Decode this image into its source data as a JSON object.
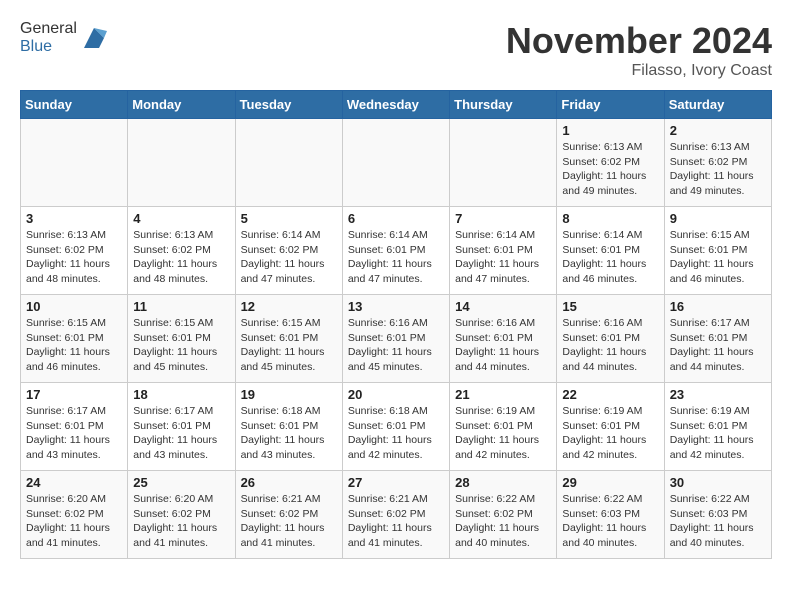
{
  "header": {
    "logo_general": "General",
    "logo_blue": "Blue",
    "month": "November 2024",
    "location": "Filasso, Ivory Coast"
  },
  "weekdays": [
    "Sunday",
    "Monday",
    "Tuesday",
    "Wednesday",
    "Thursday",
    "Friday",
    "Saturday"
  ],
  "weeks": [
    [
      {
        "day": "",
        "info": ""
      },
      {
        "day": "",
        "info": ""
      },
      {
        "day": "",
        "info": ""
      },
      {
        "day": "",
        "info": ""
      },
      {
        "day": "",
        "info": ""
      },
      {
        "day": "1",
        "info": "Sunrise: 6:13 AM\nSunset: 6:02 PM\nDaylight: 11 hours and 49 minutes."
      },
      {
        "day": "2",
        "info": "Sunrise: 6:13 AM\nSunset: 6:02 PM\nDaylight: 11 hours and 49 minutes."
      }
    ],
    [
      {
        "day": "3",
        "info": "Sunrise: 6:13 AM\nSunset: 6:02 PM\nDaylight: 11 hours and 48 minutes."
      },
      {
        "day": "4",
        "info": "Sunrise: 6:13 AM\nSunset: 6:02 PM\nDaylight: 11 hours and 48 minutes."
      },
      {
        "day": "5",
        "info": "Sunrise: 6:14 AM\nSunset: 6:02 PM\nDaylight: 11 hours and 47 minutes."
      },
      {
        "day": "6",
        "info": "Sunrise: 6:14 AM\nSunset: 6:01 PM\nDaylight: 11 hours and 47 minutes."
      },
      {
        "day": "7",
        "info": "Sunrise: 6:14 AM\nSunset: 6:01 PM\nDaylight: 11 hours and 47 minutes."
      },
      {
        "day": "8",
        "info": "Sunrise: 6:14 AM\nSunset: 6:01 PM\nDaylight: 11 hours and 46 minutes."
      },
      {
        "day": "9",
        "info": "Sunrise: 6:15 AM\nSunset: 6:01 PM\nDaylight: 11 hours and 46 minutes."
      }
    ],
    [
      {
        "day": "10",
        "info": "Sunrise: 6:15 AM\nSunset: 6:01 PM\nDaylight: 11 hours and 46 minutes."
      },
      {
        "day": "11",
        "info": "Sunrise: 6:15 AM\nSunset: 6:01 PM\nDaylight: 11 hours and 45 minutes."
      },
      {
        "day": "12",
        "info": "Sunrise: 6:15 AM\nSunset: 6:01 PM\nDaylight: 11 hours and 45 minutes."
      },
      {
        "day": "13",
        "info": "Sunrise: 6:16 AM\nSunset: 6:01 PM\nDaylight: 11 hours and 45 minutes."
      },
      {
        "day": "14",
        "info": "Sunrise: 6:16 AM\nSunset: 6:01 PM\nDaylight: 11 hours and 44 minutes."
      },
      {
        "day": "15",
        "info": "Sunrise: 6:16 AM\nSunset: 6:01 PM\nDaylight: 11 hours and 44 minutes."
      },
      {
        "day": "16",
        "info": "Sunrise: 6:17 AM\nSunset: 6:01 PM\nDaylight: 11 hours and 44 minutes."
      }
    ],
    [
      {
        "day": "17",
        "info": "Sunrise: 6:17 AM\nSunset: 6:01 PM\nDaylight: 11 hours and 43 minutes."
      },
      {
        "day": "18",
        "info": "Sunrise: 6:17 AM\nSunset: 6:01 PM\nDaylight: 11 hours and 43 minutes."
      },
      {
        "day": "19",
        "info": "Sunrise: 6:18 AM\nSunset: 6:01 PM\nDaylight: 11 hours and 43 minutes."
      },
      {
        "day": "20",
        "info": "Sunrise: 6:18 AM\nSunset: 6:01 PM\nDaylight: 11 hours and 42 minutes."
      },
      {
        "day": "21",
        "info": "Sunrise: 6:19 AM\nSunset: 6:01 PM\nDaylight: 11 hours and 42 minutes."
      },
      {
        "day": "22",
        "info": "Sunrise: 6:19 AM\nSunset: 6:01 PM\nDaylight: 11 hours and 42 minutes."
      },
      {
        "day": "23",
        "info": "Sunrise: 6:19 AM\nSunset: 6:01 PM\nDaylight: 11 hours and 42 minutes."
      }
    ],
    [
      {
        "day": "24",
        "info": "Sunrise: 6:20 AM\nSunset: 6:02 PM\nDaylight: 11 hours and 41 minutes."
      },
      {
        "day": "25",
        "info": "Sunrise: 6:20 AM\nSunset: 6:02 PM\nDaylight: 11 hours and 41 minutes."
      },
      {
        "day": "26",
        "info": "Sunrise: 6:21 AM\nSunset: 6:02 PM\nDaylight: 11 hours and 41 minutes."
      },
      {
        "day": "27",
        "info": "Sunrise: 6:21 AM\nSunset: 6:02 PM\nDaylight: 11 hours and 41 minutes."
      },
      {
        "day": "28",
        "info": "Sunrise: 6:22 AM\nSunset: 6:02 PM\nDaylight: 11 hours and 40 minutes."
      },
      {
        "day": "29",
        "info": "Sunrise: 6:22 AM\nSunset: 6:03 PM\nDaylight: 11 hours and 40 minutes."
      },
      {
        "day": "30",
        "info": "Sunrise: 6:22 AM\nSunset: 6:03 PM\nDaylight: 11 hours and 40 minutes."
      }
    ]
  ]
}
